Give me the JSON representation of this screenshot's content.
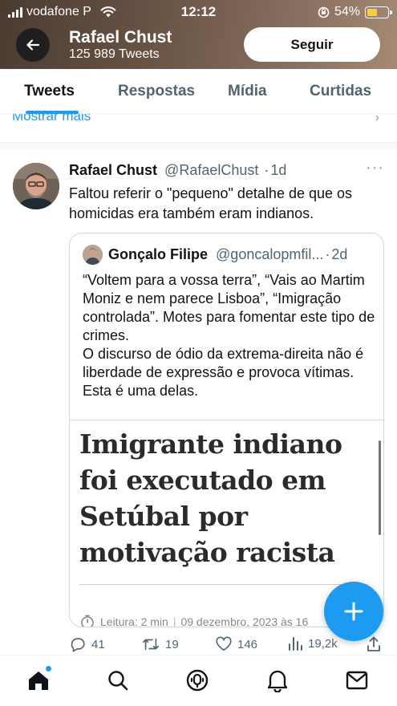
{
  "status_bar": {
    "carrier": "vodafone P",
    "time": "12:12",
    "battery": "54%",
    "battery_level": 0.54
  },
  "header": {
    "name": "Rafael Chust",
    "tweet_count": "125 989 Tweets",
    "follow_label": "Seguir"
  },
  "tabs": [
    {
      "label": "Tweets",
      "active": true
    },
    {
      "label": "Respostas",
      "active": false
    },
    {
      "label": "Mídia",
      "active": false
    },
    {
      "label": "Curtidas",
      "active": false
    }
  ],
  "show_more": {
    "label": "Mostrar mais"
  },
  "tweet": {
    "name": "Rafael Chust",
    "handle": "@RafaelChust",
    "time": "1d",
    "text": "Faltou referir o \"pequeno\" detalhe de que os homicidas era também eram indianos.",
    "quote": {
      "name": "Gonçalo Filipe",
      "handle": "@goncalopmfil...",
      "time": "2d",
      "text_p1": "“Voltem para a vossa terra”, “Vais ao Martim Moniz e nem parece Lisboa”, “Imigração controlada”. Motes para fomentar este tipo de crimes.",
      "text_p2": "O discurso de ódio da extrema-direita não é liberdade de expressão e provoca vítimas. Esta é uma delas.",
      "article": {
        "title": "Imigrante indiano foi executado em Setúbal por motivação racista",
        "reading_time": "Leitura: 2 min",
        "date": "09 dezembro, 2023 às 16"
      }
    },
    "actions": {
      "replies": "41",
      "retweets": "19",
      "likes": "146",
      "views": "19,2k"
    }
  },
  "colors": {
    "accent": "#1d9bf0",
    "text_primary": "#0f1419",
    "text_secondary": "#536471"
  }
}
